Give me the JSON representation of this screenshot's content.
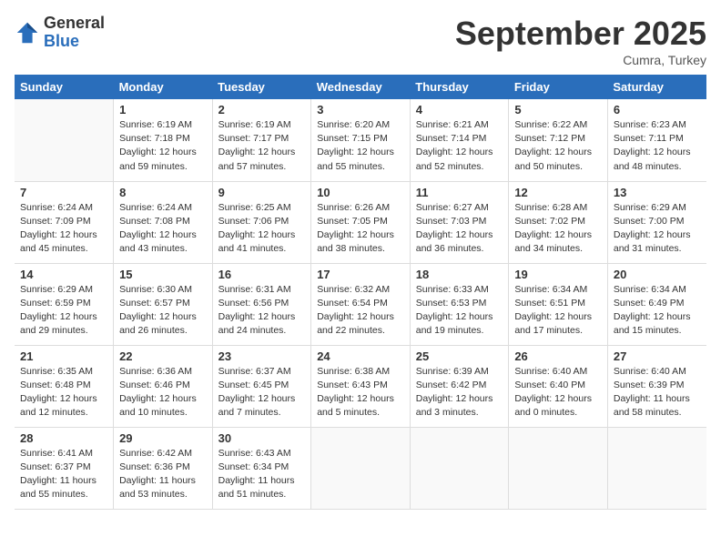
{
  "header": {
    "logo_general": "General",
    "logo_blue": "Blue",
    "month_title": "September 2025",
    "location": "Cumra, Turkey"
  },
  "days_of_week": [
    "Sunday",
    "Monday",
    "Tuesday",
    "Wednesday",
    "Thursday",
    "Friday",
    "Saturday"
  ],
  "weeks": [
    [
      {
        "day": "",
        "sunrise": "",
        "sunset": "",
        "daylight": ""
      },
      {
        "day": "1",
        "sunrise": "Sunrise: 6:19 AM",
        "sunset": "Sunset: 7:18 PM",
        "daylight": "Daylight: 12 hours and 59 minutes."
      },
      {
        "day": "2",
        "sunrise": "Sunrise: 6:19 AM",
        "sunset": "Sunset: 7:17 PM",
        "daylight": "Daylight: 12 hours and 57 minutes."
      },
      {
        "day": "3",
        "sunrise": "Sunrise: 6:20 AM",
        "sunset": "Sunset: 7:15 PM",
        "daylight": "Daylight: 12 hours and 55 minutes."
      },
      {
        "day": "4",
        "sunrise": "Sunrise: 6:21 AM",
        "sunset": "Sunset: 7:14 PM",
        "daylight": "Daylight: 12 hours and 52 minutes."
      },
      {
        "day": "5",
        "sunrise": "Sunrise: 6:22 AM",
        "sunset": "Sunset: 7:12 PM",
        "daylight": "Daylight: 12 hours and 50 minutes."
      },
      {
        "day": "6",
        "sunrise": "Sunrise: 6:23 AM",
        "sunset": "Sunset: 7:11 PM",
        "daylight": "Daylight: 12 hours and 48 minutes."
      }
    ],
    [
      {
        "day": "7",
        "sunrise": "Sunrise: 6:24 AM",
        "sunset": "Sunset: 7:09 PM",
        "daylight": "Daylight: 12 hours and 45 minutes."
      },
      {
        "day": "8",
        "sunrise": "Sunrise: 6:24 AM",
        "sunset": "Sunset: 7:08 PM",
        "daylight": "Daylight: 12 hours and 43 minutes."
      },
      {
        "day": "9",
        "sunrise": "Sunrise: 6:25 AM",
        "sunset": "Sunset: 7:06 PM",
        "daylight": "Daylight: 12 hours and 41 minutes."
      },
      {
        "day": "10",
        "sunrise": "Sunrise: 6:26 AM",
        "sunset": "Sunset: 7:05 PM",
        "daylight": "Daylight: 12 hours and 38 minutes."
      },
      {
        "day": "11",
        "sunrise": "Sunrise: 6:27 AM",
        "sunset": "Sunset: 7:03 PM",
        "daylight": "Daylight: 12 hours and 36 minutes."
      },
      {
        "day": "12",
        "sunrise": "Sunrise: 6:28 AM",
        "sunset": "Sunset: 7:02 PM",
        "daylight": "Daylight: 12 hours and 34 minutes."
      },
      {
        "day": "13",
        "sunrise": "Sunrise: 6:29 AM",
        "sunset": "Sunset: 7:00 PM",
        "daylight": "Daylight: 12 hours and 31 minutes."
      }
    ],
    [
      {
        "day": "14",
        "sunrise": "Sunrise: 6:29 AM",
        "sunset": "Sunset: 6:59 PM",
        "daylight": "Daylight: 12 hours and 29 minutes."
      },
      {
        "day": "15",
        "sunrise": "Sunrise: 6:30 AM",
        "sunset": "Sunset: 6:57 PM",
        "daylight": "Daylight: 12 hours and 26 minutes."
      },
      {
        "day": "16",
        "sunrise": "Sunrise: 6:31 AM",
        "sunset": "Sunset: 6:56 PM",
        "daylight": "Daylight: 12 hours and 24 minutes."
      },
      {
        "day": "17",
        "sunrise": "Sunrise: 6:32 AM",
        "sunset": "Sunset: 6:54 PM",
        "daylight": "Daylight: 12 hours and 22 minutes."
      },
      {
        "day": "18",
        "sunrise": "Sunrise: 6:33 AM",
        "sunset": "Sunset: 6:53 PM",
        "daylight": "Daylight: 12 hours and 19 minutes."
      },
      {
        "day": "19",
        "sunrise": "Sunrise: 6:34 AM",
        "sunset": "Sunset: 6:51 PM",
        "daylight": "Daylight: 12 hours and 17 minutes."
      },
      {
        "day": "20",
        "sunrise": "Sunrise: 6:34 AM",
        "sunset": "Sunset: 6:49 PM",
        "daylight": "Daylight: 12 hours and 15 minutes."
      }
    ],
    [
      {
        "day": "21",
        "sunrise": "Sunrise: 6:35 AM",
        "sunset": "Sunset: 6:48 PM",
        "daylight": "Daylight: 12 hours and 12 minutes."
      },
      {
        "day": "22",
        "sunrise": "Sunrise: 6:36 AM",
        "sunset": "Sunset: 6:46 PM",
        "daylight": "Daylight: 12 hours and 10 minutes."
      },
      {
        "day": "23",
        "sunrise": "Sunrise: 6:37 AM",
        "sunset": "Sunset: 6:45 PM",
        "daylight": "Daylight: 12 hours and 7 minutes."
      },
      {
        "day": "24",
        "sunrise": "Sunrise: 6:38 AM",
        "sunset": "Sunset: 6:43 PM",
        "daylight": "Daylight: 12 hours and 5 minutes."
      },
      {
        "day": "25",
        "sunrise": "Sunrise: 6:39 AM",
        "sunset": "Sunset: 6:42 PM",
        "daylight": "Daylight: 12 hours and 3 minutes."
      },
      {
        "day": "26",
        "sunrise": "Sunrise: 6:40 AM",
        "sunset": "Sunset: 6:40 PM",
        "daylight": "Daylight: 12 hours and 0 minutes."
      },
      {
        "day": "27",
        "sunrise": "Sunrise: 6:40 AM",
        "sunset": "Sunset: 6:39 PM",
        "daylight": "Daylight: 11 hours and 58 minutes."
      }
    ],
    [
      {
        "day": "28",
        "sunrise": "Sunrise: 6:41 AM",
        "sunset": "Sunset: 6:37 PM",
        "daylight": "Daylight: 11 hours and 55 minutes."
      },
      {
        "day": "29",
        "sunrise": "Sunrise: 6:42 AM",
        "sunset": "Sunset: 6:36 PM",
        "daylight": "Daylight: 11 hours and 53 minutes."
      },
      {
        "day": "30",
        "sunrise": "Sunrise: 6:43 AM",
        "sunset": "Sunset: 6:34 PM",
        "daylight": "Daylight: 11 hours and 51 minutes."
      },
      {
        "day": "",
        "sunrise": "",
        "sunset": "",
        "daylight": ""
      },
      {
        "day": "",
        "sunrise": "",
        "sunset": "",
        "daylight": ""
      },
      {
        "day": "",
        "sunrise": "",
        "sunset": "",
        "daylight": ""
      },
      {
        "day": "",
        "sunrise": "",
        "sunset": "",
        "daylight": ""
      }
    ]
  ]
}
